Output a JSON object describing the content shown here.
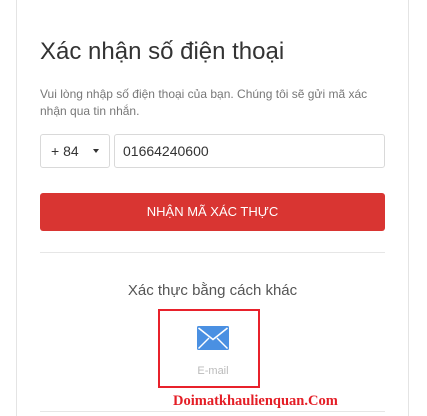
{
  "title": "Xác nhận số điện thoại",
  "description": "Vui lòng nhập số điện thoại của bạn. Chúng tôi sẽ gửi mã xác nhận qua tin nhắn.",
  "country_code": {
    "selected": "+ 84"
  },
  "phone": {
    "value": "01664240600"
  },
  "verify_button": {
    "label": "NHẬN MÃ XÁC THỰC"
  },
  "alternative": {
    "title": "Xác thực bằng cách khác",
    "email": {
      "label": "E-mail",
      "icon": "envelope-icon"
    }
  },
  "watermark": {
    "text": "Doimatkhaulienquan.Com"
  },
  "colors": {
    "accent": "#d93532",
    "highlight": "#e8212b",
    "email_icon": "#4a90e2",
    "watermark": "#e41e26"
  }
}
